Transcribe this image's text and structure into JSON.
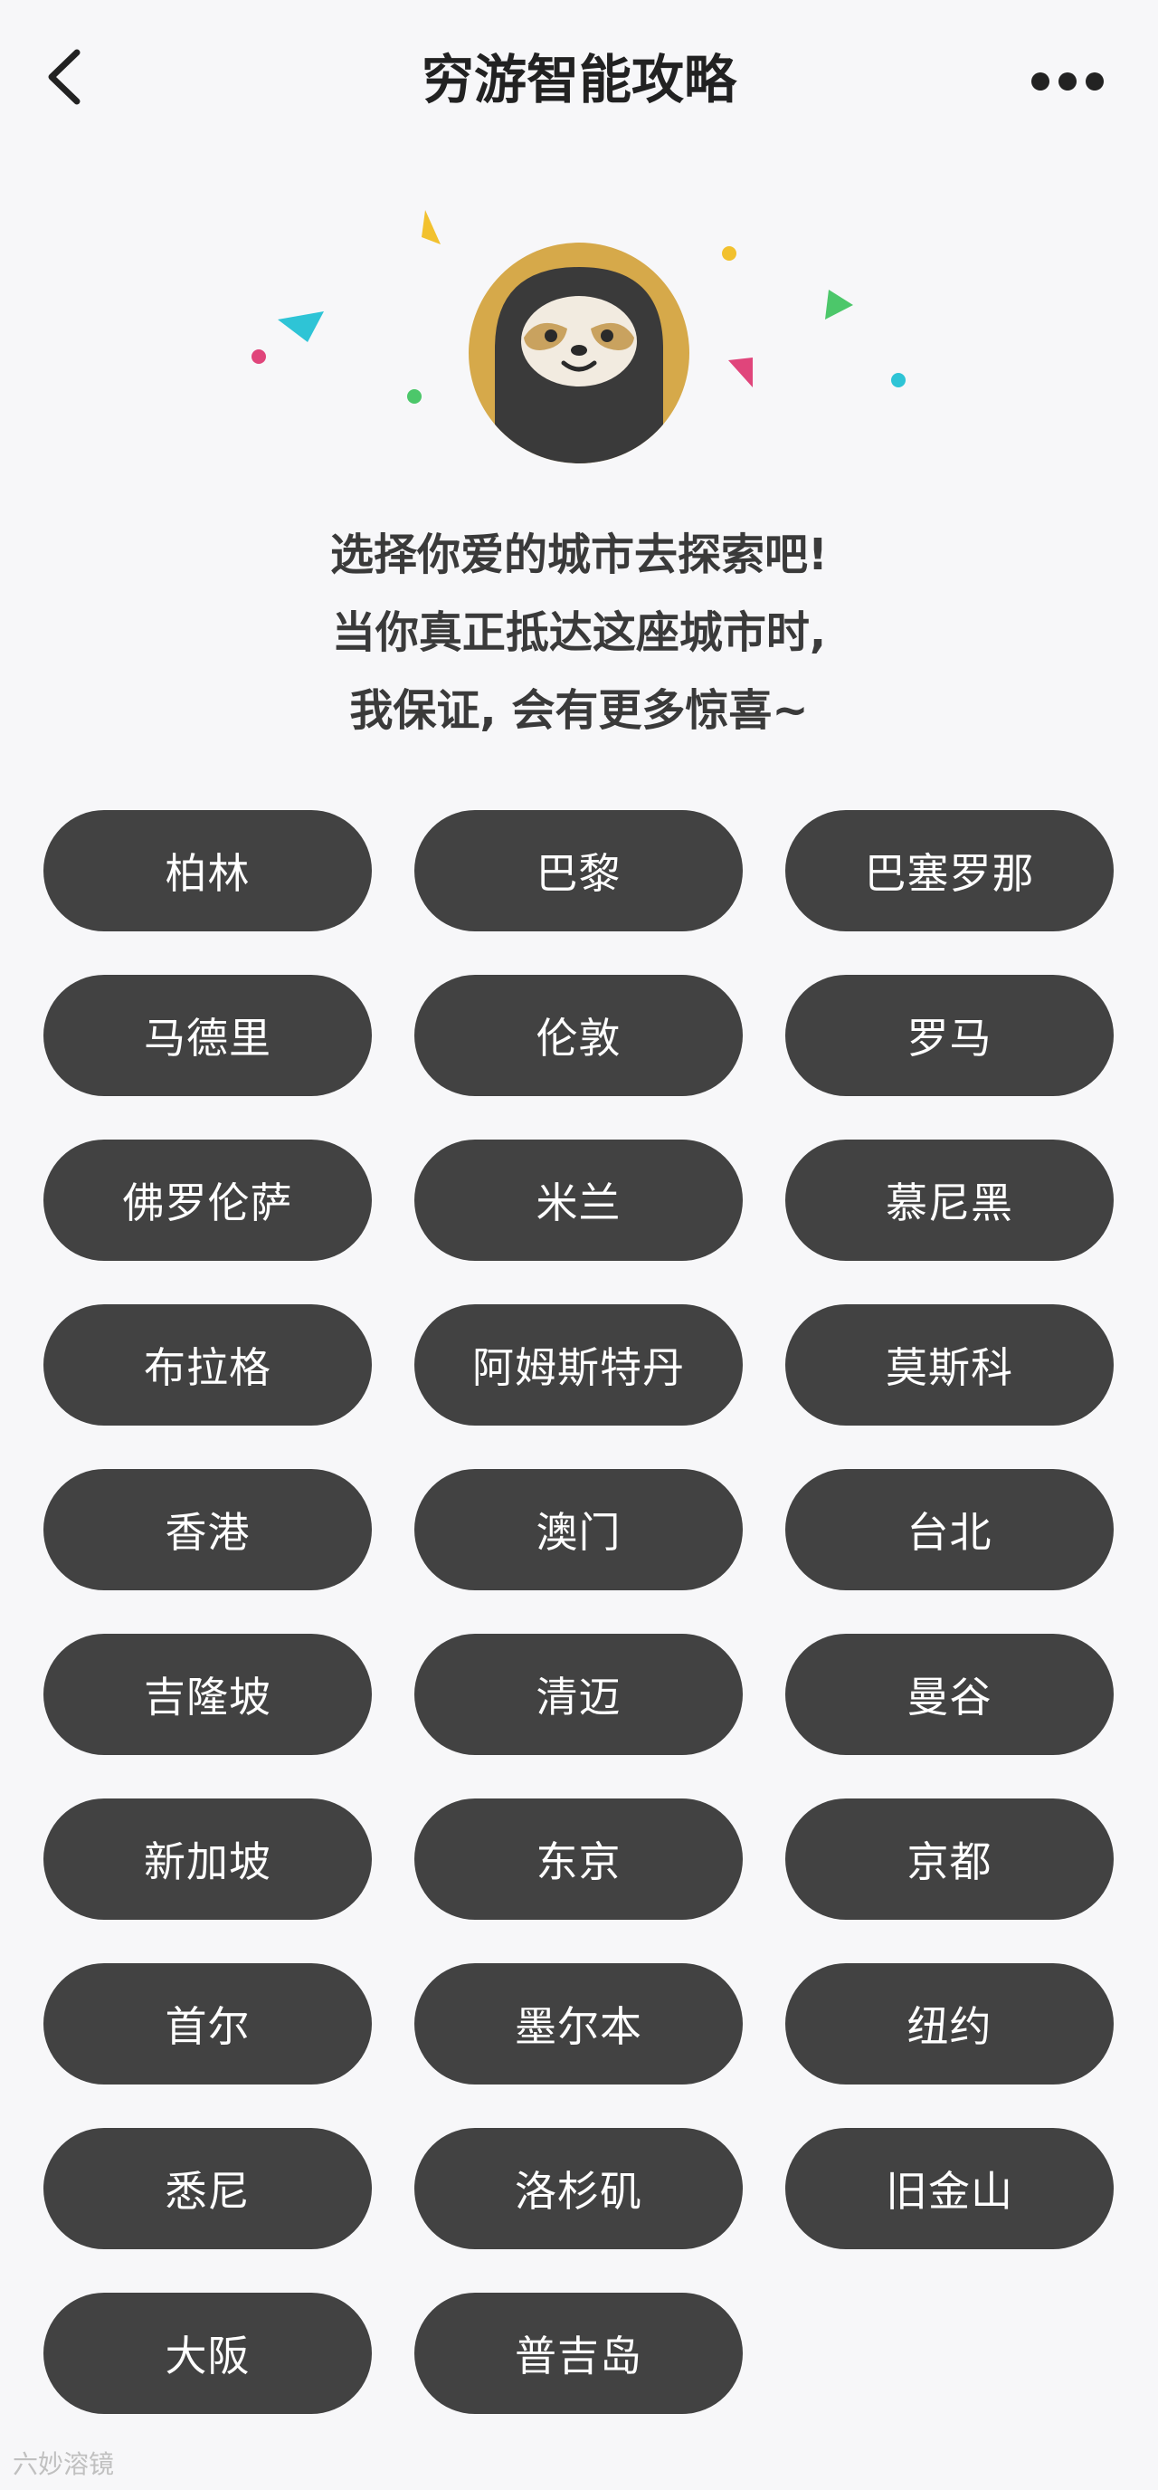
{
  "header": {
    "title": "穷游智能攻略",
    "back_icon": "chevron-left-icon",
    "more_icon": "more-dots-icon"
  },
  "intro": {
    "line1": "选择你爱的城市去探索吧!",
    "line2": "当你真正抵达这座城市时,",
    "line3": "我保证, 会有更多惊喜~"
  },
  "colors": {
    "button_bg": "#424242",
    "button_text": "#ffffff",
    "background": "#f7f7f9",
    "mascot_ring": "#d6a94a",
    "confetti_pink": "#e0457b",
    "confetti_cyan": "#2ec4d6",
    "confetti_green": "#4cc76a",
    "confetti_yellow": "#f2c12e"
  },
  "cities": [
    "柏林",
    "巴黎",
    "巴塞罗那",
    "马德里",
    "伦敦",
    "罗马",
    "佛罗伦萨",
    "米兰",
    "慕尼黑",
    "布拉格",
    "阿姆斯特丹",
    "莫斯科",
    "香港",
    "澳门",
    "台北",
    "吉隆坡",
    "清迈",
    "曼谷",
    "新加坡",
    "东京",
    "京都",
    "首尔",
    "墨尔本",
    "纽约",
    "悉尼",
    "洛杉矶",
    "旧金山",
    "大阪",
    "普吉岛"
  ],
  "watermark": {
    "text": "六妙溶镜"
  }
}
